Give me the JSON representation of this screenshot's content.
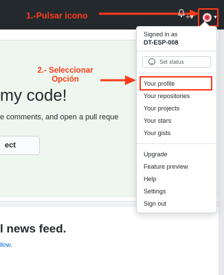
{
  "annotations": {
    "step1": "1.-Pulsar icono",
    "step2_line1": "2.- Seleccionar",
    "step2_line2": "Opción"
  },
  "header": {
    "icons": [
      "bell-icon",
      "plus-icon",
      "avatar"
    ]
  },
  "page": {
    "hero_title": "my code!",
    "hero_sub": "e comments, and open a pull reque",
    "hero_button": "ect",
    "feed_title": "l news feed.",
    "feed_link": "llow."
  },
  "dropdown": {
    "signed_in_label": "Signed in as",
    "username": "DT-ESP-008",
    "set_status": "Set status",
    "menu_group1": [
      "Your profile",
      "Your repositories",
      "Your projects",
      "Your stars",
      "Your gists"
    ],
    "menu_group2": [
      "Upgrade",
      "Feature preview",
      "Help",
      "Settings",
      "Sign out"
    ],
    "highlighted_item": "Your profile"
  },
  "colors": {
    "annotation": "#ff3b1a",
    "topbar": "#24292e",
    "hero_bg": "#eef7ef",
    "link": "#0366d6"
  }
}
